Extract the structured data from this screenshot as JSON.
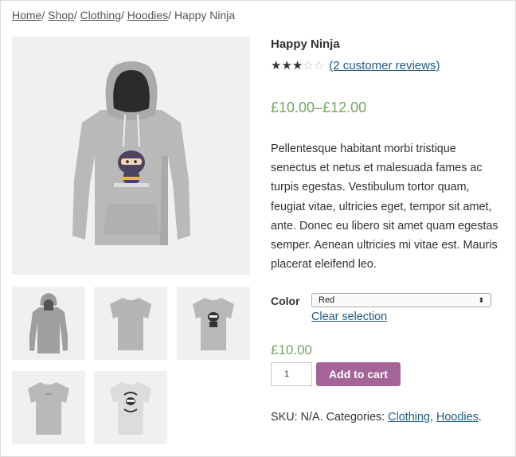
{
  "breadcrumb": {
    "home": "Home",
    "sep1": "/ ",
    "shop": "Shop",
    "sep2": "/ ",
    "clothing": "Clothing",
    "sep3": "/ ",
    "hoodies": "Hoodies",
    "sep4": "/ ",
    "current": "Happy Ninja"
  },
  "product": {
    "title": "Happy Ninja",
    "rating": 3,
    "rating_max": 5,
    "reviews_link": "(2 customer reviews)",
    "price_range": "£10.00–£12.00",
    "description": "Pellentesque habitant morbi tristique senectus et netus et malesuada fames ac turpis egestas. Vestibulum tortor quam, feugiat vitae, ultricies eget, tempor sit amet, ante. Donec eu libero sit amet quam egestas semper. Aenean ultricies mi vitae est. Mauris placerat eleifend leo.",
    "color_label": "Color",
    "color_selected": "Red",
    "clear_selection": "Clear selection",
    "variation_price": "£10.00",
    "quantity": "1",
    "add_to_cart": "Add to cart",
    "meta_prefix": "SKU: N/A. Categories: ",
    "category_1": "Clothing",
    "meta_comma": ", ",
    "category_2": "Hoodies",
    "meta_suffix": "."
  },
  "colors": {
    "price_green": "#77a464",
    "button_purple": "#a46497",
    "link_blue": "#1e5a83"
  },
  "icons": {
    "star_filled": "★",
    "star_empty": "☆",
    "select_arrow": "⬍"
  }
}
